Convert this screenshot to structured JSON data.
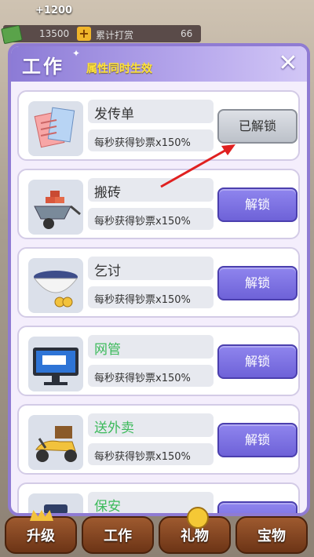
{
  "top": {
    "gain": "+1200",
    "money": "13500",
    "plus": "+",
    "reward_label": "累计打赏",
    "reward_value": "66"
  },
  "panel": {
    "title": "工作",
    "subtitle": "属性同时生效",
    "close": "✕"
  },
  "jobs": [
    {
      "name": "发传单",
      "desc": "每秒获得钞票x150%",
      "button": "已解锁",
      "state": "unlocked",
      "icon": "flyer-icon"
    },
    {
      "name": "搬砖",
      "desc": "每秒获得钞票x150%",
      "button": "解锁",
      "state": "locked",
      "icon": "wheelbarrow-bricks-icon"
    },
    {
      "name": "乞讨",
      "desc": "每秒获得钞票x150%",
      "button": "解锁",
      "state": "locked",
      "icon": "begging-bowl-icon"
    },
    {
      "name": "网管",
      "desc": "每秒获得钞票x150%",
      "button": "解锁",
      "state": "locked",
      "icon": "monitor-icon"
    },
    {
      "name": "送外卖",
      "desc": "每秒获得钞票x150%",
      "button": "解锁",
      "state": "locked",
      "icon": "scooter-icon"
    },
    {
      "name": "保安",
      "desc": "",
      "button": "",
      "state": "locked",
      "icon": "security-icon"
    }
  ],
  "nav": [
    "升级",
    "工作",
    "礼物",
    "宝物"
  ],
  "colors": {
    "accent": "#8f7bd3",
    "button": "#7a6fe0",
    "green_name": "#3cba5b",
    "arrow": "#e02020"
  }
}
